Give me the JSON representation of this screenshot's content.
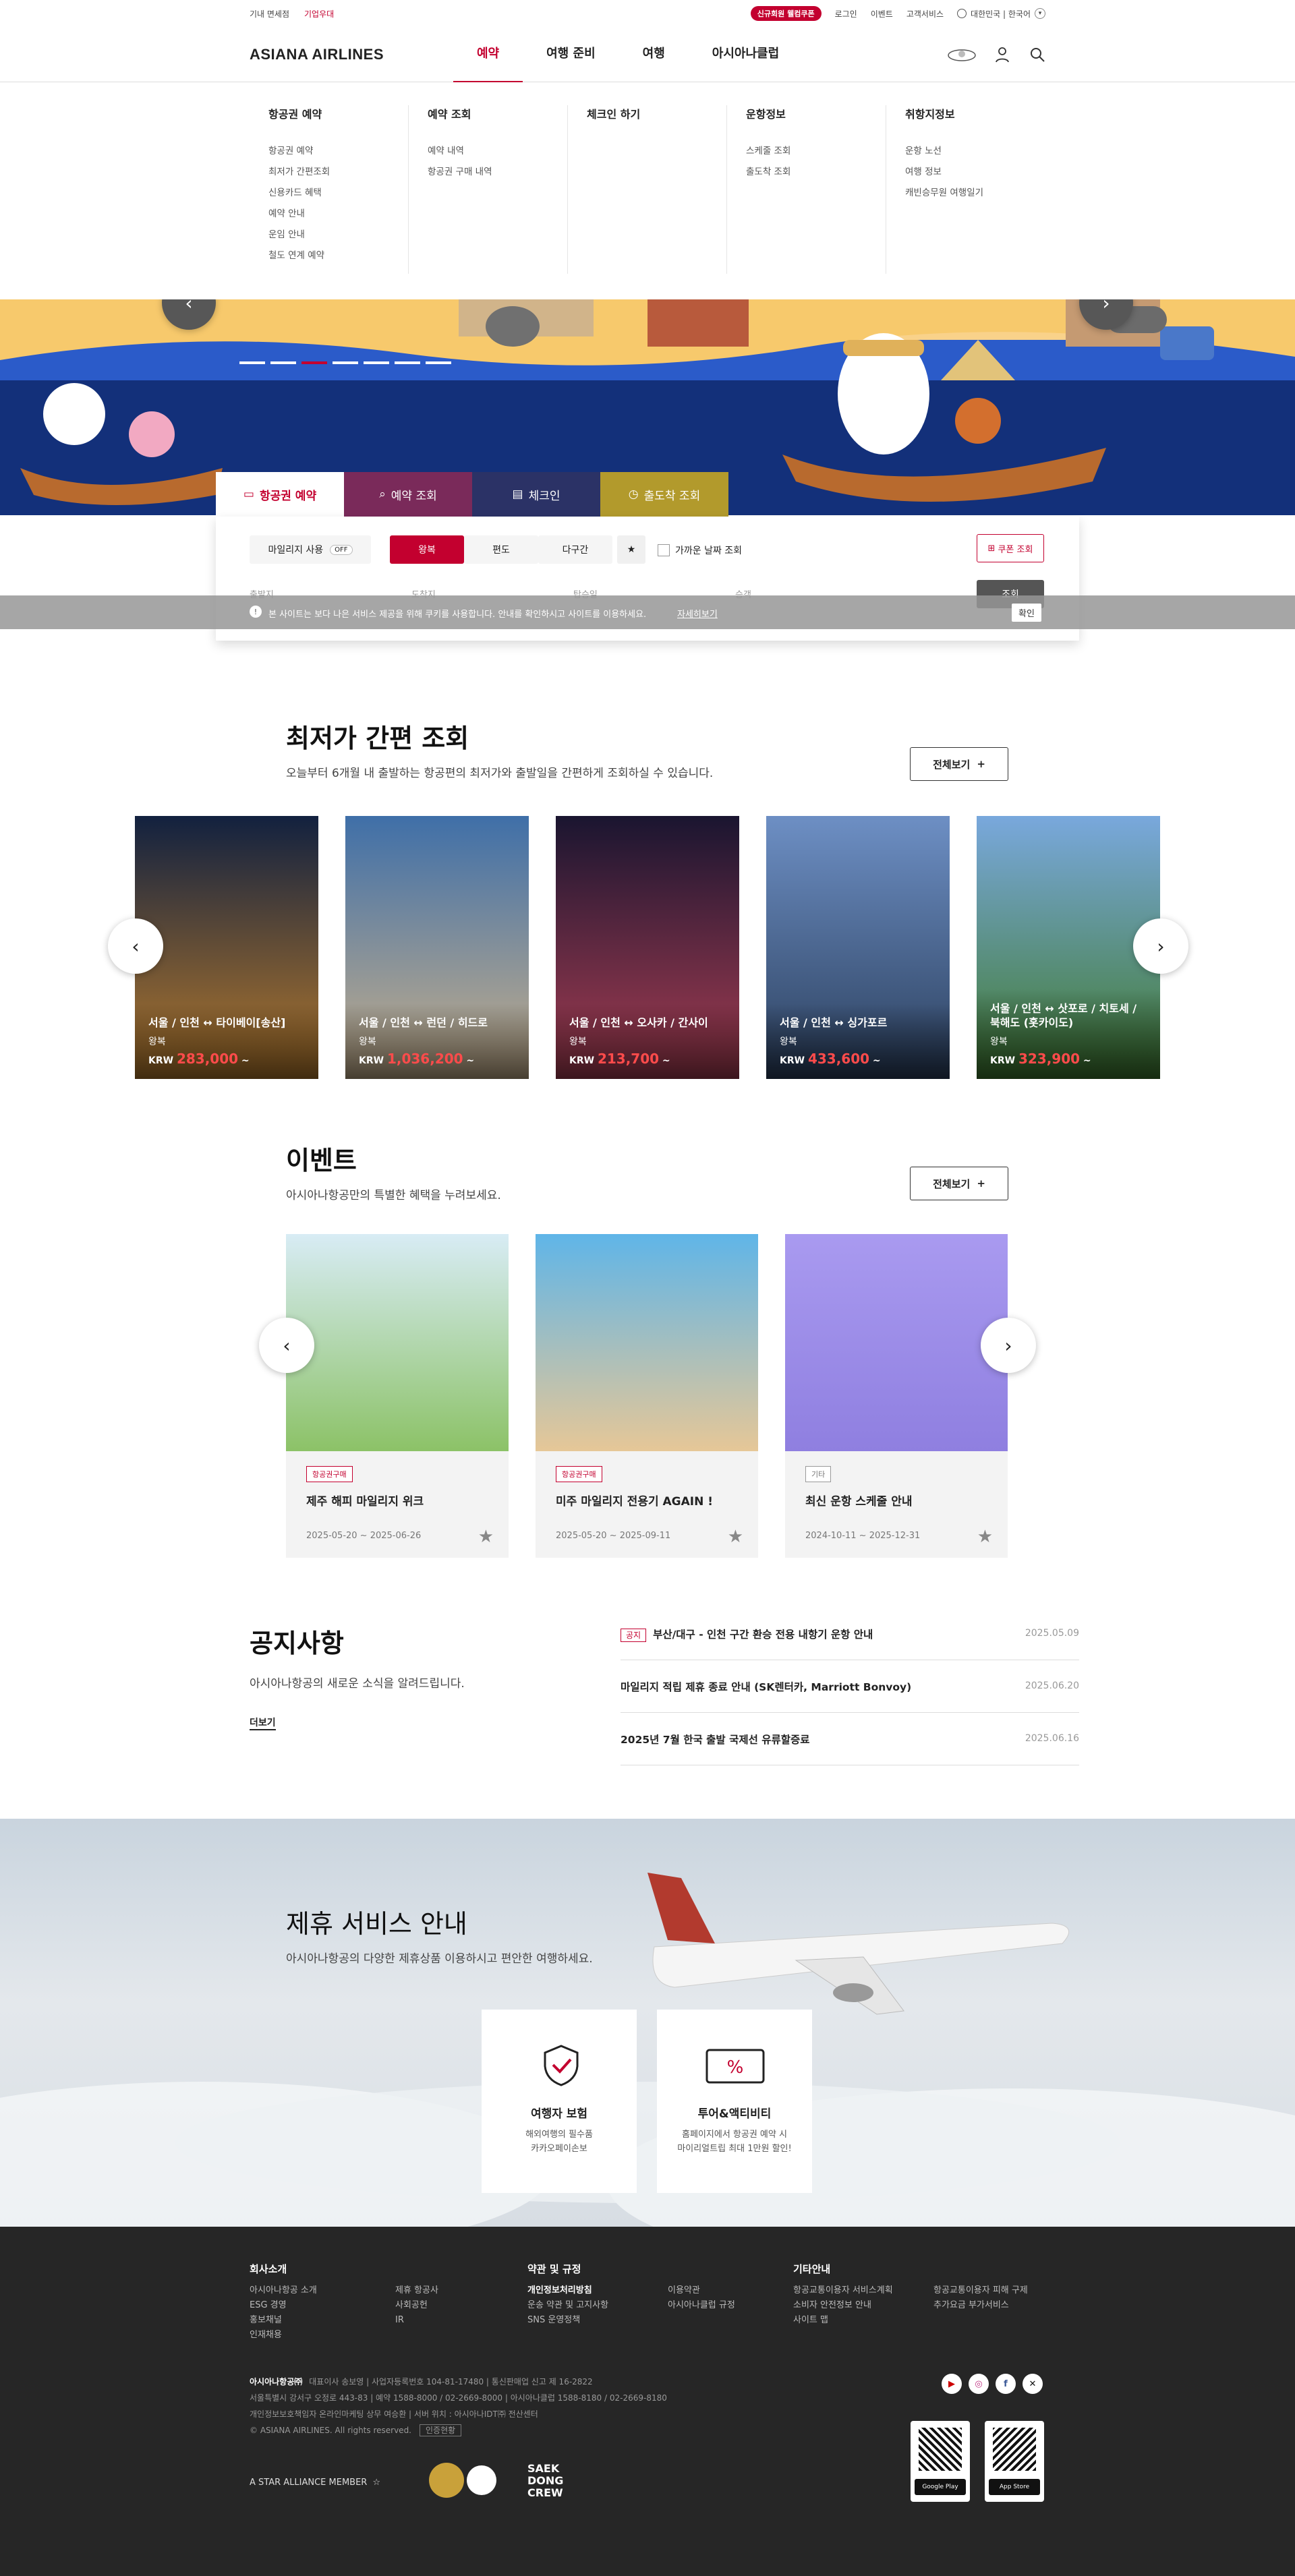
{
  "util": {
    "left": [
      "기내 면세점",
      "기업우대"
    ],
    "coupon": "신규회원 웰컴쿠폰",
    "right": [
      "로그인",
      "이벤트",
      "고객서비스"
    ],
    "lang": "대한민국 | 한국어"
  },
  "logo": "ASIANA AIRLINES",
  "gnb": [
    "예약",
    "여행 준비",
    "여행",
    "아시아나클럽"
  ],
  "mega": [
    {
      "title": "항공권 예약",
      "items": [
        "항공권 예약",
        "최저가 간편조회",
        "신용카드 혜택",
        "예약 안내",
        "운임 안내",
        "철도 연계 예약"
      ]
    },
    {
      "title": "예약 조회",
      "items": [
        "예약 내역",
        "항공권 구매 내역"
      ]
    },
    {
      "title": "체크인 하기",
      "items": []
    },
    {
      "title": "운항정보",
      "items": [
        "스케줄 조회",
        "출도착 조회"
      ]
    },
    {
      "title": "취항지정보",
      "items": [
        "운항 노선",
        "여행 정보",
        "캐빈승무원 여행일기"
      ]
    }
  ],
  "booking": {
    "tabs": [
      "항공권 예약",
      "예약 조회",
      "체크인",
      "출도착 조회"
    ],
    "mileage": "마일리지 사용",
    "off": "OFF",
    "trip": [
      "왕복",
      "편도",
      "다구간"
    ],
    "near": "가까운 날짜 조회",
    "coupon": "쿠폰 조회",
    "fields": [
      "출발지",
      "도착지",
      "탑승일",
      "승객",
      "조회"
    ]
  },
  "cookie": {
    "text": "본 사이트는 보다 나은 서비스 제공을 위해 쿠키를 사용합니다. 안내를 확인하시고 사이트를 이용하세요.",
    "more": "자세히보기",
    "ok": "확인"
  },
  "lowest": {
    "title": "최저가 간편 조회",
    "sub": "오늘부터 6개월 내 출발하는 항공편의 최저가와 출발일을 간편하게 조회하실 수 있습니다.",
    "all": "전체보기",
    "cards": [
      {
        "route": "서울 / 인천 ↔ 타이베이[송산]",
        "type": "왕복",
        "cur": "KRW",
        "price": "283,000",
        "colors": [
          "#12213f",
          "#b57a2d"
        ]
      },
      {
        "route": "서울 / 인천 ↔ 런던 / 히드로",
        "type": "왕복",
        "cur": "KRW",
        "price": "1,036,200",
        "colors": [
          "#3f6fa8",
          "#c7b08c"
        ]
      },
      {
        "route": "서울 / 인천 ↔ 오사카 / 간사이",
        "type": "왕복",
        "cur": "KRW",
        "price": "213,700",
        "colors": [
          "#1a1530",
          "#a73d52"
        ]
      },
      {
        "route": "서울 / 인천 ↔ 싱가포르",
        "type": "왕복",
        "cur": "KRW",
        "price": "433,600",
        "colors": [
          "#6d8fc4",
          "#2b3f5d"
        ]
      },
      {
        "route": "서울 / 인천 ↔ 삿포로 / 치토세 / 북해도 (홋카이도)",
        "type": "왕복",
        "cur": "KRW",
        "price": "323,900",
        "colors": [
          "#79a8dd",
          "#3f7a2e"
        ]
      }
    ]
  },
  "events": {
    "title": "이벤트",
    "sub": "아시아나항공만의 특별한 혜택을 누려보세요.",
    "all": "전체보기",
    "items": [
      {
        "badge": "항공권구매",
        "title": "제주 해피 마일리지 위크",
        "date": "2025-05-20 ~ 2025-06-26",
        "colors": [
          "#d8ecf5",
          "#8cc267"
        ]
      },
      {
        "badge": "항공권구매",
        "title": "미주 마일리지 전용기 AGAIN !",
        "date": "2025-05-20 ~ 2025-09-11",
        "colors": [
          "#5fb5e8",
          "#e6c797"
        ]
      },
      {
        "badge": "기타",
        "title": "최신 운항 스케줄 안내",
        "date": "2024-10-11 ~ 2025-12-31",
        "colors": [
          "#a99af0",
          "#8f7fe0"
        ]
      }
    ]
  },
  "notice": {
    "title": "공지사항",
    "sub": "아시아나항공의 새로운 소식을 알려드립니다.",
    "more": "더보기",
    "items": [
      {
        "tag": "공지",
        "title": "부산/대구 - 인천 구간 환승 전용 내항기 운항 안내",
        "date": "2025.05.09"
      },
      {
        "tag": "",
        "title": "마일리지 적립 제휴 종료 안내 (SK렌터카, Marriott Bonvoy)",
        "date": "2025.06.20"
      },
      {
        "tag": "",
        "title": "2025년 7월 한국 출발 국제선 유류할증료",
        "date": "2025.06.16"
      }
    ]
  },
  "partner": {
    "title": "제휴 서비스 안내",
    "sub": "아시아나항공의 다양한 제휴상품 이용하시고 편안한 여행하세요.",
    "cards": [
      {
        "title": "여행자 보험",
        "desc1": "해외여행의 필수품",
        "desc2": "카카오페이손보"
      },
      {
        "title": "투어&액티비티",
        "desc1": "홈페이지에서 항공권 예약 시",
        "desc2": "마이리얼트립 최대 1만원 할인!"
      }
    ]
  },
  "footer": {
    "c1": {
      "title": "회사소개",
      "a": [
        "아시아나항공 소개",
        "ESG 경영",
        "홍보채널",
        "인재채용"
      ],
      "b": [
        "제휴 항공사",
        "사회공헌",
        "IR"
      ]
    },
    "c2": {
      "title": "약관 및 규정",
      "a": [
        "개인정보처리방침",
        "운송 약관 및 고지사항",
        "SNS 운영정책"
      ],
      "b": [
        "이용약관",
        "아시아나클럽 규정"
      ]
    },
    "c3": {
      "title": "기타안내",
      "a": [
        "항공교통이용자 서비스계획",
        "소비자 안전정보 안내",
        "사이트 맵"
      ],
      "b": [
        "항공교통이용자 피해 구제",
        "추가요금 부가서비스"
      ]
    },
    "company": "아시아나항공㈜",
    "info1": "대표이사 송보영 | 사업자등록번호 104-81-17480 | 통신판매업 신고 제 16-2822",
    "info2": "서울특별시 강서구 오정로 443-83 | 예약 1588-8000 / 02-2669-8000 | 아시아나클럽 1588-8180 / 02-2669-8180",
    "info3": "개인정보보호책임자 온라인마케팅 상무 여승환 | 서버 위치 : 아시아나IDT㈜ 전산센터",
    "copy": "© ASIANA AIRLINES. All rights reserved.",
    "cert": "인증현황",
    "star": "A STAR ALLIANCE MEMBER",
    "saek": "SAEK DONG CREW",
    "gp": "Google Play",
    "as": "App Store"
  },
  "colors": {
    "brand": "#c3002f",
    "purple": "#7a2a5a",
    "navy": "#2b3266",
    "olive": "#b29a2c"
  }
}
